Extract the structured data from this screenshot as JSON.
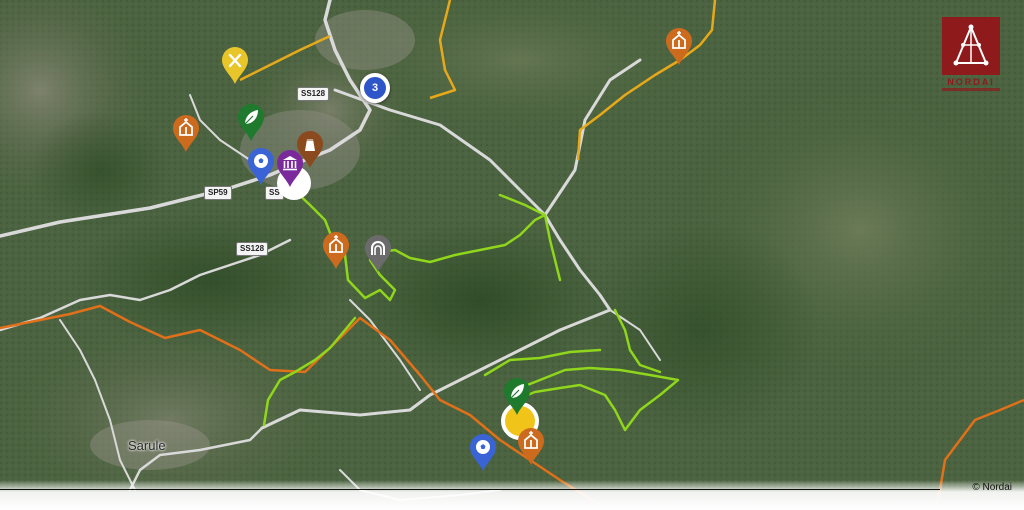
{
  "map": {
    "places": [
      {
        "id": "sarule",
        "label": "Sarule"
      }
    ],
    "road_shields": [
      "SS128",
      "SP59",
      "SS",
      "SS128"
    ],
    "cluster": {
      "count": "3",
      "color": "#2f56c9"
    },
    "pins": [
      {
        "id": "restaurant",
        "icon": "cutlery-icon",
        "color": "#e8c62a"
      },
      {
        "id": "church-nw",
        "icon": "church-icon",
        "color": "#cc6a1e"
      },
      {
        "id": "nature-n",
        "icon": "leaf-icon",
        "color": "#1f7a2e"
      },
      {
        "id": "sport-n",
        "icon": "soccer-ball-icon",
        "color": "#3a63d6"
      },
      {
        "id": "museum",
        "icon": "museum-icon",
        "color": "#7b2a9c"
      },
      {
        "id": "archaeo",
        "icon": "nuraghe-icon",
        "color": "#8a4a1e"
      },
      {
        "id": "church-c",
        "icon": "church-icon",
        "color": "#cc6a1e"
      },
      {
        "id": "tunnel",
        "icon": "cave-icon",
        "color": "#6b6b6b"
      },
      {
        "id": "church-ne",
        "icon": "church-icon",
        "color": "#cc6a1e"
      },
      {
        "id": "nature-s",
        "icon": "leaf-icon",
        "color": "#1f7a2e"
      },
      {
        "id": "sport-s",
        "icon": "soccer-ball-icon",
        "color": "#3a63d6"
      },
      {
        "id": "church-s",
        "icon": "church-icon",
        "color": "#cc6a1e"
      }
    ],
    "trails": {
      "green": "#8fd61c",
      "orange": "#e0701a",
      "yellow": "#e7a91a"
    }
  },
  "logo": {
    "name": "NORDAI",
    "color": "#8e1a1c"
  },
  "attribution": "© Nordai"
}
